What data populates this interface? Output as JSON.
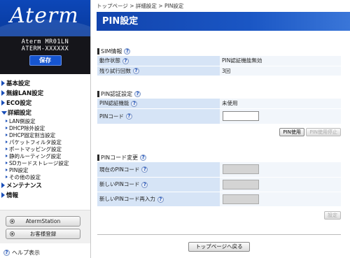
{
  "logo": {
    "text": "Aterm"
  },
  "device": {
    "model": "Aterm MR01LN",
    "name": "ATERM-XXXXXX",
    "save_label": "保存"
  },
  "menu": {
    "top1": "基本設定",
    "top2": "無線LAN設定",
    "top3": "ECO設定",
    "top4": "詳細設定",
    "sub": [
      "LAN側設定",
      "DHCP除外設定",
      "DHCP固定割当設定",
      "パケットフィルタ設定",
      "ポートマッピング設定",
      "静的ルーティング設定",
      "SDカードストレージ設定",
      "PIN設定",
      "その他の設定"
    ],
    "top5": "メンテナンス",
    "top6": "情報"
  },
  "side_buttons": {
    "station": "AtermStation",
    "register": "お客様登録"
  },
  "help": {
    "label": "ヘルプ表示",
    "icon": "?"
  },
  "breadcrumb": "トップページ > 詳細設定 > PIN設定",
  "page_title": "PIN設定",
  "sim": {
    "heading": "SIM情報",
    "status_label": "動作状態",
    "status_value": "PIN認証機能無効",
    "retries_label": "残り試行回数",
    "retries_value": "3回"
  },
  "pin_auth": {
    "heading": "PIN認証設定",
    "func_label": "PIN認証機能",
    "func_value": "未使用",
    "code_label": "PINコード",
    "code_value": "",
    "use_btn": "PIN使用",
    "stop_btn": "PIN使用停止"
  },
  "pin_change": {
    "heading": "PINコード変更",
    "current_label": "現在のPINコード",
    "new_label": "新しいPINコード",
    "confirm_label": "新しいPINコード再入力",
    "set_btn": "設定"
  },
  "back_btn": "トップページへ戻る"
}
